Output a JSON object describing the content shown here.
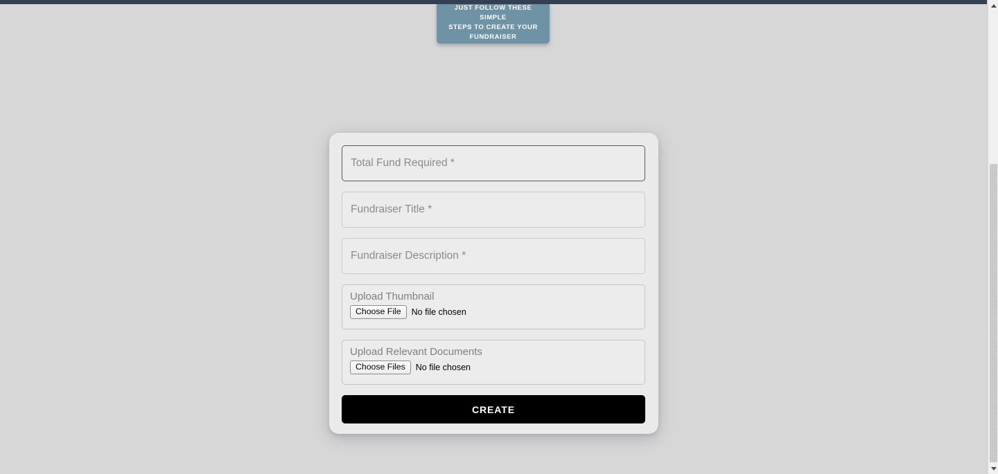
{
  "window": {
    "navbar_color": "#343f54",
    "page_background": "#d7d7d7"
  },
  "callout": {
    "text": "JUST FOLLOW THESE SIMPLE\nSTEPS TO CREATE YOUR\nFUNDRAISER",
    "background_color": "#6e93a4",
    "text_color": "#ffffff"
  },
  "form": {
    "card_background": "#eaeaea",
    "fields": [
      {
        "name": "total-fund-required",
        "placeholder": "Total Fund Required *",
        "value": "",
        "focused": true
      },
      {
        "name": "fundraiser-title",
        "placeholder": "Fundraiser Title *",
        "value": "",
        "focused": false
      },
      {
        "name": "fundraiser-description",
        "placeholder": "Fundraiser Description *",
        "value": "",
        "focused": false
      }
    ],
    "uploads": [
      {
        "name": "upload-thumbnail",
        "label": "Upload Thumbnail",
        "button_label": "Choose File",
        "status": "No file chosen",
        "multiple": false
      },
      {
        "name": "upload-relevant-documents",
        "label": "Upload Relevant Documents",
        "button_label": "Choose Files",
        "status": "No file chosen",
        "multiple": true
      }
    ],
    "submit": {
      "label": "CREATE",
      "background_color": "#000000",
      "text_color": "#ffffff"
    }
  },
  "scrollbars": {
    "outer": {
      "up_arrow_icon": "triangle-up-icon",
      "down_arrow_icon": "triangle-down-icon"
    }
  }
}
